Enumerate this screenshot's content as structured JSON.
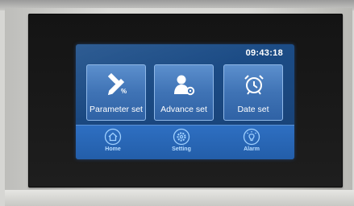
{
  "status_bar": {
    "time": "09:43:18"
  },
  "tiles": [
    {
      "label": "Parameter set",
      "icon": "pencil-ruler-icon"
    },
    {
      "label": "Advance set",
      "icon": "user-gear-icon"
    },
    {
      "label": "Date set",
      "icon": "alarm-clock-icon"
    }
  ],
  "nav": [
    {
      "label": "Home",
      "icon": "home-icon"
    },
    {
      "label": "Setting",
      "icon": "gear-icon"
    },
    {
      "label": "Alarm",
      "icon": "bulb-icon"
    }
  ],
  "colors": {
    "screen_background": "#1b4a83",
    "tile_background": "#3f73b5",
    "tile_border": "#8fb8e8",
    "nav_background": "#2865b5",
    "nav_icon": "#9fd0ff",
    "bezel": "#1a1a1a"
  }
}
